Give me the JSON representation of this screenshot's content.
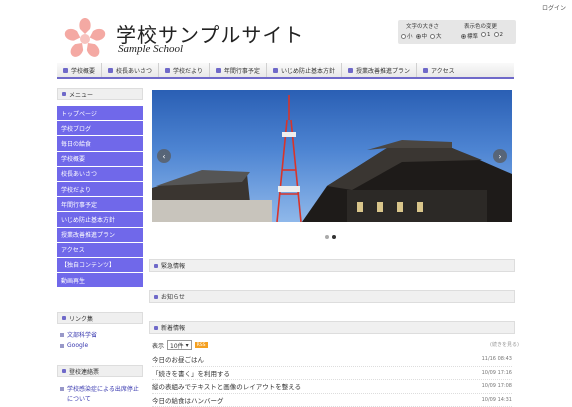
{
  "header": {
    "login": "ログイン",
    "title": "学校サンプルサイト",
    "subtitle": "Sample School",
    "font_size": {
      "heading": "文字の大きさ",
      "options": [
        "小",
        "中",
        "大"
      ],
      "selected": 1
    },
    "color_scheme": {
      "heading": "表示色の変更",
      "options": [
        "標準",
        "1",
        "2"
      ],
      "selected": 0
    }
  },
  "gnav": [
    "学校概要",
    "校長あいさつ",
    "学校だより",
    "年間行事予定",
    "いじめ防止基本方針",
    "授業改善推進プラン",
    "アクセス"
  ],
  "sidebar": {
    "menu_heading": "メニュー",
    "menu": [
      "トップページ",
      "学校ブログ",
      "毎日の給食",
      "学校概要",
      "校長あいさつ",
      "学校だより",
      "年間行事予定",
      "いじめ防止基本方針",
      "授業改善推進プラン",
      "アクセス",
      "【独自コンテンツ】",
      "動画再生"
    ],
    "links_heading": "リンク集",
    "links": [
      "文部科学省",
      "Google"
    ],
    "contact_heading": "登校連絡票",
    "contact_text": "学校感染症による出席停止",
    "contact_text2": "について"
  },
  "slider": {
    "active_dot": 1,
    "dot_count": 2,
    "prev_icon": "‹",
    "next_icon": "›"
  },
  "sections": {
    "urgent": "緊急情報",
    "notice": "お知らせ",
    "news": "新着情報"
  },
  "news": {
    "sort_label": "表示",
    "count_option": "10件",
    "rss": "RSS",
    "more": "(続きを見る)",
    "items": [
      {
        "title": "今日のお昼ごはん",
        "date": "11/16 08:43"
      },
      {
        "title": "「続きを書く」を利用する",
        "date": "10/09 17:16"
      },
      {
        "title": "縦の表組みでテキストと画像のレイアウトを整える",
        "date": "10/09 17:08"
      },
      {
        "title": "今日の給食はハンバーグ",
        "date": "10/09 14:31"
      }
    ]
  },
  "colors": {
    "accent": "#6f69c9",
    "menu_bg": "#7068ea",
    "logo": "#f2a0a0"
  }
}
